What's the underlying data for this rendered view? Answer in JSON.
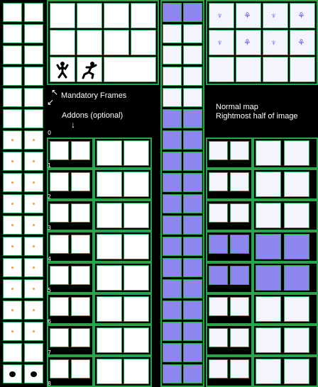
{
  "labels": {
    "mandatory": "Mandatory Frames",
    "addons": "Addons  (optional)",
    "normal_line1": "Normal map",
    "normal_line2": "Rightmost half of image"
  },
  "addon_indices": [
    "0",
    "1",
    "2",
    "3",
    "4",
    "5",
    "6",
    "7",
    "8"
  ],
  "icons": {
    "stick_figure": "stick-figure-icon",
    "running_figure": "running-figure-icon",
    "arrow_down": "arrow-down-icon",
    "arrow_diag": "arrow-diagonal-icon"
  },
  "colors": {
    "background": "#000000",
    "frame_border": "#2aa44a",
    "normal_fill": "#8c86ee",
    "accent_orange": "#f0a040",
    "accent_purple": "#7a3aa0"
  }
}
